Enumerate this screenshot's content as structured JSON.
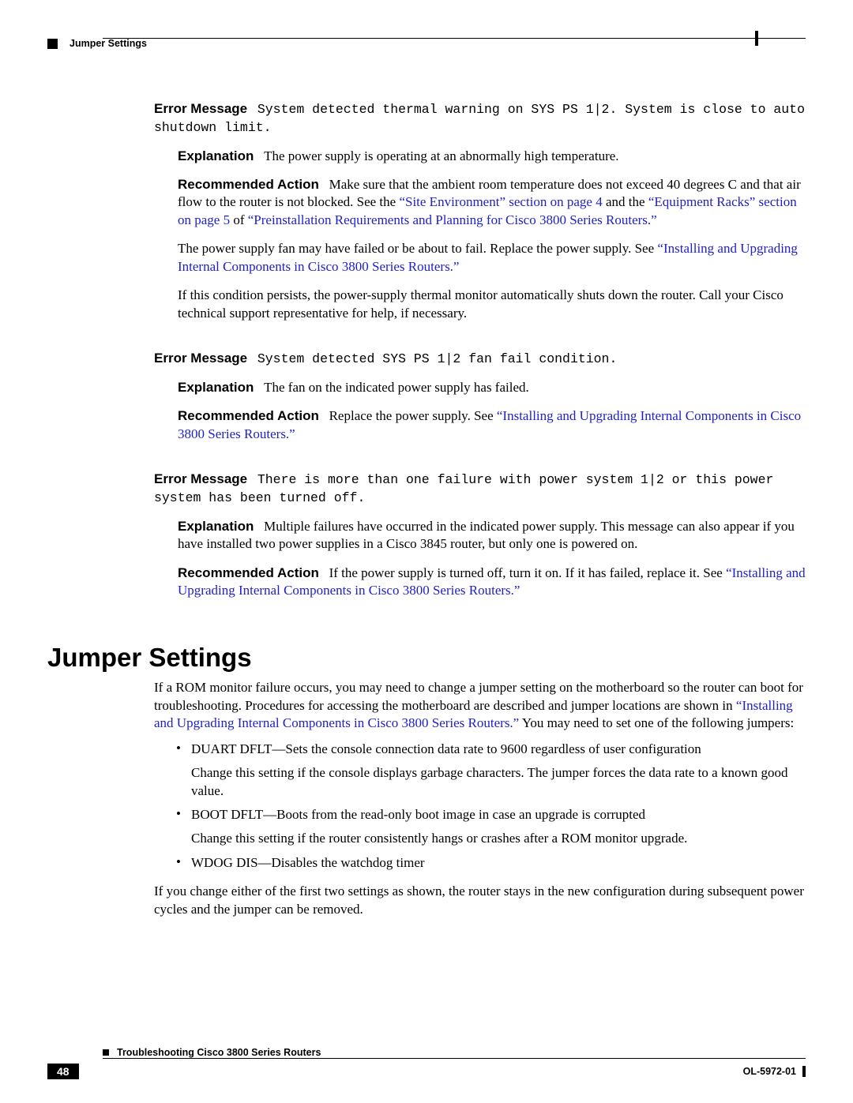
{
  "header": {
    "section_title": "Jumper Settings"
  },
  "block1": {
    "err_label": "Error Message",
    "err_msg": "System detected thermal warning on SYS PS 1|2. System is close to auto shutdown limit.",
    "expl_label": "Explanation",
    "expl_text": "The power supply is operating at an abnormally high temperature.",
    "rec_label": "Recommended Action",
    "rec_t1": "Make sure that the ambient room temperature does not exceed 40 degrees C and that air flow to the router is not blocked. See the ",
    "rec_l1": "“Site Environment” section on page 4",
    "rec_t2": " and the ",
    "rec_l2": "“Equipment Racks” section on page 5",
    "rec_t3": " of ",
    "rec_l3": "“Preinstallation Requirements and Planning for Cisco 3800 Series Routers.”",
    "p2_t1": "The power supply fan may have failed or be about to fail. Replace the power supply. See ",
    "p2_l1": "“Installing and Upgrading Internal Components in Cisco 3800 Series Routers.”",
    "p3": "If this condition persists, the power-supply thermal monitor automatically shuts down the router. Call your Cisco technical support representative for help, if necessary."
  },
  "block2": {
    "err_label": "Error Message",
    "err_msg": "System detected SYS PS 1|2 fan fail condition.",
    "expl_label": "Explanation",
    "expl_text": "The fan on the indicated power supply has failed.",
    "rec_label": "Recommended Action",
    "rec_t1": "Replace the power supply. See ",
    "rec_l1": "“Installing and Upgrading Internal Components in Cisco 3800 Series Routers.”"
  },
  "block3": {
    "err_label": "Error Message",
    "err_msg": "There is more than one failure with power system 1|2 or this power system has been turned off.",
    "expl_label": "Explanation",
    "expl_text": "Multiple failures have occurred in the indicated power supply. This message can also appear if you have installed two power supplies in a Cisco 3845 router, but only one is powered on.",
    "rec_label": "Recommended Action",
    "rec_t1": "If the power supply is turned off, turn it on. If it has failed, replace it. See ",
    "rec_l1": "“Installing and Upgrading Internal Components in Cisco 3800 Series Routers.”"
  },
  "jumper": {
    "heading": "Jumper Settings",
    "intro_t1": "If a ROM monitor failure occurs, you may need to change a jumper setting on the motherboard so the router can boot for troubleshooting. Procedures for accessing the motherboard are described and jumper locations are shown in ",
    "intro_l1": "“Installing and Upgrading Internal Components in Cisco 3800 Series Routers.”",
    "intro_t2": " You may need to set one of the following jumpers:",
    "b1": "DUART DFLT—Sets the console connection data rate to 9600 regardless of user configuration",
    "b1_f": "Change this setting if the console displays garbage characters. The jumper forces the data rate to a known good value.",
    "b2": "BOOT DFLT—Boots from the read-only boot image in case an upgrade is corrupted",
    "b2_f": "Change this setting if the router consistently hangs or crashes after a ROM monitor upgrade.",
    "b3": "WDOG DIS—Disables the watchdog timer",
    "outro": "If you change either of the first two settings as shown, the router stays in the new configuration during subsequent power cycles and the jumper can be removed."
  },
  "footer": {
    "title": "Troubleshooting Cisco 3800 Series Routers",
    "page": "48",
    "docid": "OL-5972-01"
  }
}
